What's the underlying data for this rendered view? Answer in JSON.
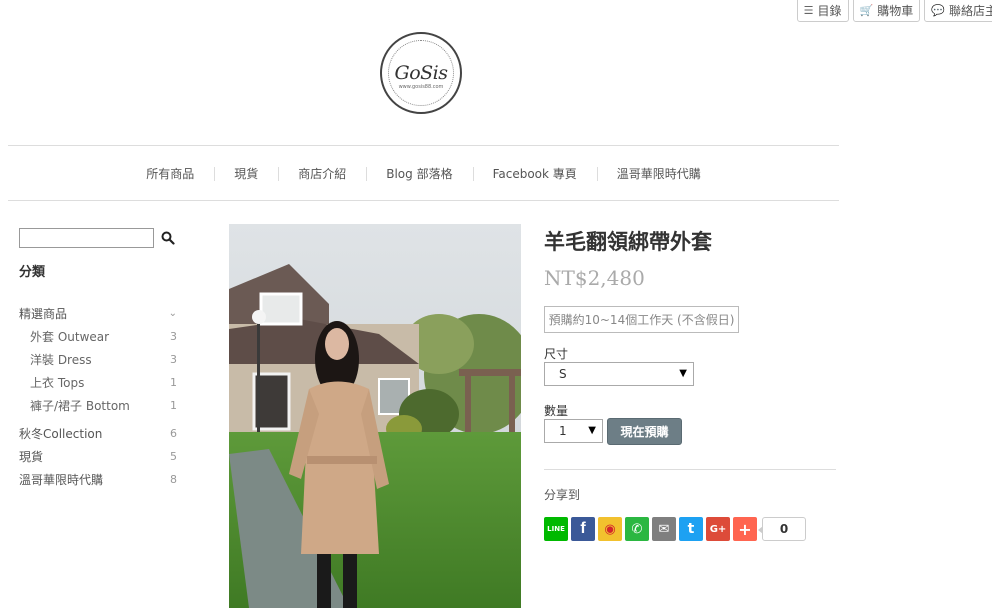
{
  "util_bar": [
    {
      "icon": "list-icon",
      "label": "目錄"
    },
    {
      "icon": "cart-icon",
      "label": "購物車"
    },
    {
      "icon": "chat-icon",
      "label": "聯絡店主"
    }
  ],
  "logo": {
    "text": "GoSis",
    "sub": "www.gosis88.com"
  },
  "nav": [
    "所有商品",
    "現貨",
    "商店介紹",
    "Blog 部落格",
    "Facebook 專頁",
    "溫哥華限時代購"
  ],
  "sidebar": {
    "category_title": "分類",
    "categories": [
      {
        "label": "精選商品",
        "count": "",
        "level": 0,
        "expand": "chevron-down-icon"
      },
      {
        "label": "外套 Outwear",
        "count": "3",
        "level": 1
      },
      {
        "label": "洋裝 Dress",
        "count": "3",
        "level": 1
      },
      {
        "label": "上衣 Tops",
        "count": "1",
        "level": 1
      },
      {
        "label": "褲子/裙子 Bottom",
        "count": "1",
        "level": 1
      },
      {
        "label": "秋冬Collection",
        "count": "6",
        "level": 0
      },
      {
        "label": "現貨",
        "count": "5",
        "level": 0
      },
      {
        "label": "溫哥華限時代購",
        "count": "8",
        "level": 0
      }
    ]
  },
  "product": {
    "title": "羊毛翻領綁帶外套",
    "price": "NT$2,480",
    "preorder_note": "預購約10~14個工作天 (不含假日)",
    "size_label": "尺寸",
    "size_value": "S",
    "qty_label": "數量",
    "qty_value": "1",
    "buy_label": "現在預購"
  },
  "share": {
    "label": "分享到",
    "count": "0",
    "buttons": [
      {
        "name": "line-icon",
        "color": "#00b900",
        "glyph": "LINE"
      },
      {
        "name": "facebook-icon",
        "color": "#3b5998",
        "glyph": "f"
      },
      {
        "name": "weibo-icon",
        "color": "#f2c12e",
        "glyph": "◉"
      },
      {
        "name": "whatsapp-icon",
        "color": "#2bb741",
        "glyph": "✆"
      },
      {
        "name": "email-icon",
        "color": "#7f7f7f",
        "glyph": "✉"
      },
      {
        "name": "twitter-icon",
        "color": "#1da1f2",
        "glyph": "t"
      },
      {
        "name": "google-plus-icon",
        "color": "#dd4b39",
        "glyph": "G+"
      },
      {
        "name": "more-share-icon",
        "color": "#ff6550",
        "glyph": "+"
      }
    ]
  }
}
